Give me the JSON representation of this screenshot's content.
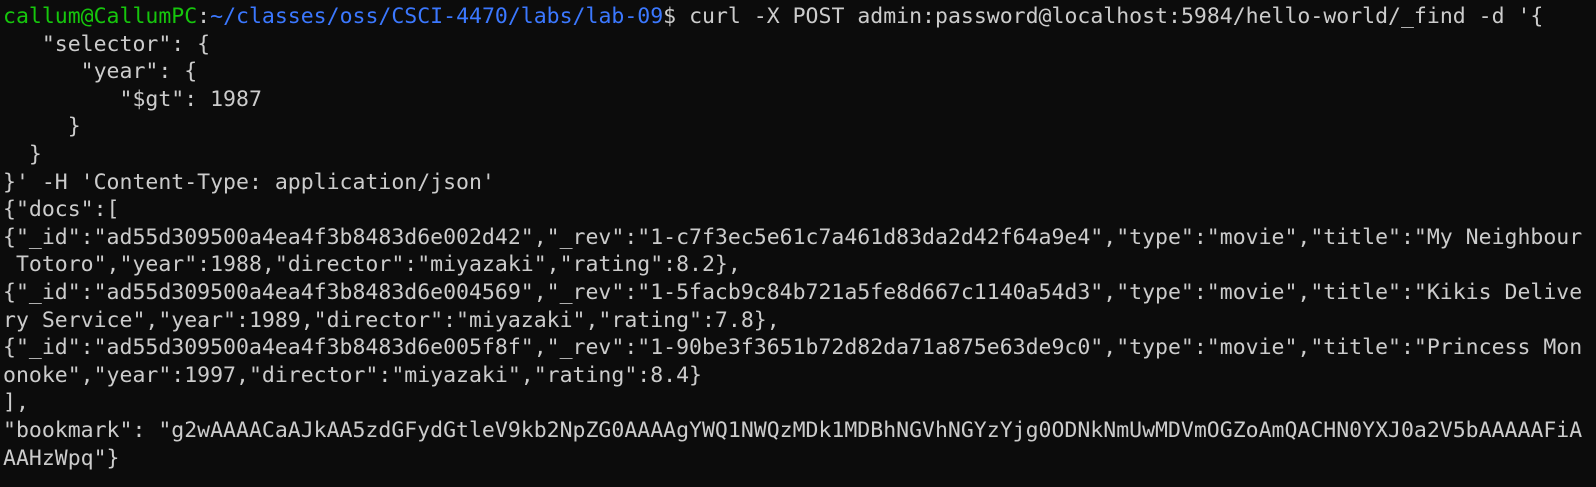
{
  "terminal": {
    "prompt": {
      "user_host": "callum@CallumPC",
      "separator": ":",
      "path": "~/classes/oss/CSCI-4470/labs/lab-09",
      "symbol": "$ ",
      "command": "curl -X POST admin:password@localhost:5984/hello-world/_find -d '{"
    },
    "lines": [
      "   \"selector\": {",
      "      \"year\": {",
      "         \"$gt\": 1987",
      "     }",
      "  }",
      "}' -H 'Content-Type: application/json'",
      "{\"docs\":[",
      "{\"_id\":\"ad55d309500a4ea4f3b8483d6e002d42\",\"_rev\":\"1-c7f3ec5e61c7a461d83da2d42f64a9e4\",\"type\":\"movie\",\"title\":\"My Neighbour",
      " Totoro\",\"year\":1988,\"director\":\"miyazaki\",\"rating\":8.2},",
      "{\"_id\":\"ad55d309500a4ea4f3b8483d6e004569\",\"_rev\":\"1-5facb9c84b721a5fe8d667c1140a54d3\",\"type\":\"movie\",\"title\":\"Kikis Delive",
      "ry Service\",\"year\":1989,\"director\":\"miyazaki\",\"rating\":7.8},",
      "{\"_id\":\"ad55d309500a4ea4f3b8483d6e005f8f\",\"_rev\":\"1-90be3f3651b72d82da71a875e63de9c0\",\"type\":\"movie\",\"title\":\"Princess Mon",
      "onoke\",\"year\":1997,\"director\":\"miyazaki\",\"rating\":8.4}",
      "],",
      "\"bookmark\": \"g2wAAAACaAJkAA5zdGFydGtleV9kb2NpZG0AAAAgYWQ1NWQzMDk1MDBhNGVhNGYzYjg0ODNkNmUwMDVmOGZoAmQACHN0YXJ0a2V5bAAAAAFiA",
      "AAHzWpq\"}"
    ]
  },
  "colors": {
    "background": "#0c0c0c",
    "text": "#cccccc",
    "user_host": "#16c60c",
    "path": "#3b78ff"
  }
}
